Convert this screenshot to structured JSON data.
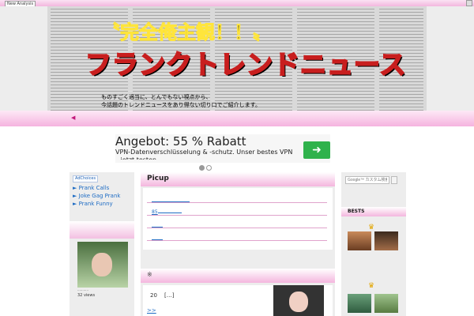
{
  "topbar": {
    "nav_label": "New Analysis"
  },
  "header": {
    "sub_title": "〝完全俺主観！！〟",
    "brand": "フランクトレンドニュース",
    "tagline_1": "ものすごく適当に、とんでもない視点から、",
    "tagline_2": "今話題のトレンドニュースをあり得ない切り口でご紹介します。"
  },
  "ad": {
    "title": "Angebot: 55 % Rabatt",
    "subtitle": "VPN-Datenverschlüsselung & -schutz. Unser bestes VPN – jetzt testen",
    "button_icon": "arrow-right-icon"
  },
  "left_sidebar": {
    "adchoices_label": "AdChoices",
    "links": [
      "Prank Calls",
      "Joke Gag Prank",
      "Prank Funny"
    ],
    "views": "32 views"
  },
  "center": {
    "section_title": "Picup",
    "number_85": "85",
    "number_20": "20",
    "ellipsis": "[…]",
    "more": ">>"
  },
  "right_sidebar": {
    "search_placeholder": "Google™ カスタム検索",
    "best_title": "BESTS"
  },
  "colors": {
    "accent_pink": "#f4b6de",
    "link_blue": "#1e6cc4",
    "ad_green": "#2fb24c"
  }
}
